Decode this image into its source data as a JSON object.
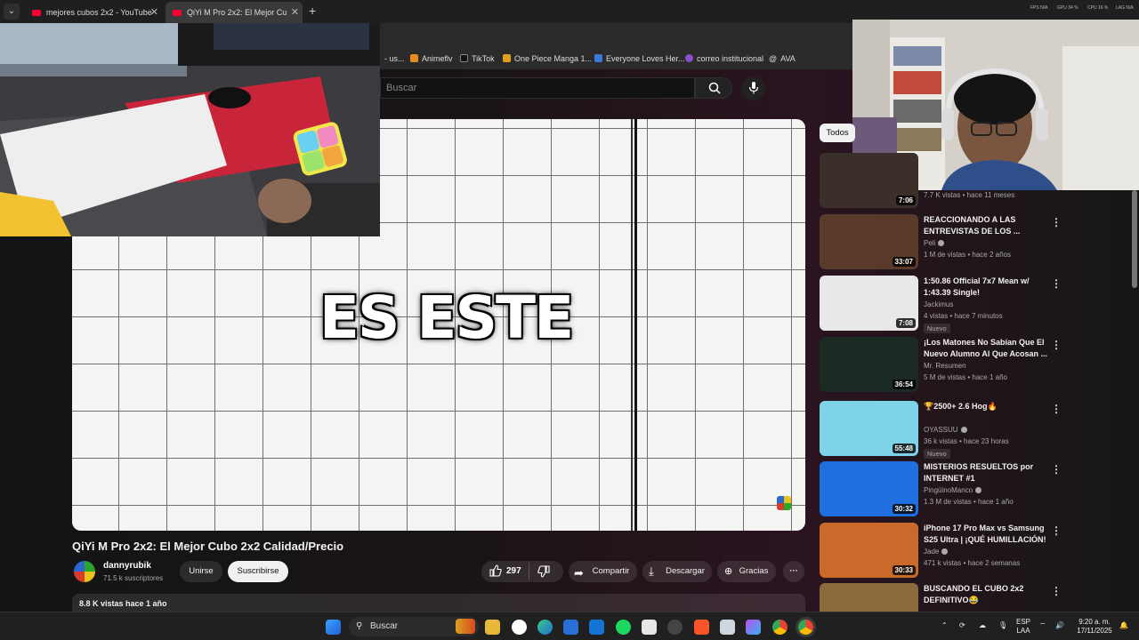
{
  "browser": {
    "tabs": [
      {
        "title": "mejores cubos 2x2 - YouTube",
        "active": false
      },
      {
        "title": "QiYi M Pro 2x2: El Mejor Cu",
        "active": true
      }
    ],
    "new_tab": "+",
    "stats": [
      "FPS N/A",
      "GPU 34 %",
      "CPU 16 %",
      "LAG N/A"
    ],
    "bookmarks": [
      {
        "label": "- us...",
        "color": "#555"
      },
      {
        "label": "Animeflv",
        "color": "#e88b1c"
      },
      {
        "label": "TikTok",
        "color": "#111"
      },
      {
        "label": "One Piece Manga 1...",
        "color": "#e0a01c"
      },
      {
        "label": "Everyone Loves Her...",
        "color": "#3b78d8"
      },
      {
        "label": "correo institucional",
        "color": "#8a4fd1"
      },
      {
        "label": "AVA",
        "color": "#666"
      }
    ]
  },
  "youtube": {
    "search_placeholder": "Buscar",
    "video_caption": "ES ESTE",
    "video_title": "QiYi M Pro 2x2: El Mejor Cubo 2x2 Calidad/Precio",
    "channel": {
      "name": "dannyrubik",
      "subs": "71.5 k suscriptores"
    },
    "actions": {
      "join": "Unirse",
      "subscribe": "Suscribirse",
      "likes": "297",
      "share": "Compartir",
      "download": "Descargar",
      "thanks": "Gracias",
      "more": "···"
    },
    "description_meta": "8.8 K vistas  hace 1 año",
    "filter_chip": "Todos",
    "recommendations": [
      {
        "title": "",
        "channel": "",
        "meta": "7.7 K vistas • hace 11 meses",
        "duration": "7:06",
        "badge": "",
        "thumb": "#3b2f2a",
        "verified": false
      },
      {
        "title": "REACCIONANDO A LAS ENTREVISTAS DE LOS ...",
        "channel": "Peli",
        "meta": "1 M de vistas • hace 2 años",
        "duration": "33:07",
        "badge": "",
        "thumb": "#5a3a2a",
        "verified": true
      },
      {
        "title": "1:50.86 Official 7x7 Mean w/ 1:43.39 Single!",
        "channel": "Jackimus",
        "meta": "4 vistas • hace 7 minutos",
        "duration": "7:08",
        "badge": "Nuevo",
        "thumb": "#e8e8e8",
        "verified": false
      },
      {
        "title": "¡Los Matones No Sabían Que El Nuevo Alumno Al Que Acosan ...",
        "channel": "Mr. Resumen",
        "meta": "5 M de vistas • hace 1 año",
        "duration": "36:54",
        "badge": "",
        "thumb": "#1b2a22",
        "verified": false
      },
      {
        "title": "🏆2500+ 2.6 Hog🔥",
        "channel": "OYASSUU",
        "meta": "36 k vistas • hace 23 horas",
        "duration": "55:48",
        "badge": "Nuevo",
        "thumb": "#7fd3e8",
        "verified": true
      },
      {
        "title": "MISTERIOS RESUELTOS por INTERNET #1",
        "channel": "PingüinoManco",
        "meta": "1.3 M de vistas • hace 1 año",
        "duration": "30:32",
        "badge": "",
        "thumb": "#1f6fe0",
        "verified": true
      },
      {
        "title": "iPhone 17 Pro Max vs Samsung S25 Ultra | ¡QUÉ HUMILLACIÓN!",
        "channel": "Jade",
        "meta": "471 k vistas • hace 2 semanas",
        "duration": "30:33",
        "badge": "",
        "thumb": "#c96a2a",
        "verified": true
      },
      {
        "title": "BUSCANDO EL CUBO 2x2 DEFINITIVO😂",
        "channel": "",
        "meta": "",
        "duration": "",
        "badge": "",
        "thumb": "#8a6a3a",
        "verified": false
      }
    ]
  },
  "taskbar": {
    "search_label": "Buscar",
    "lang": "ESP",
    "lang2": "LAA",
    "time": "9:20 a. m.",
    "date": "17/11/2025"
  }
}
